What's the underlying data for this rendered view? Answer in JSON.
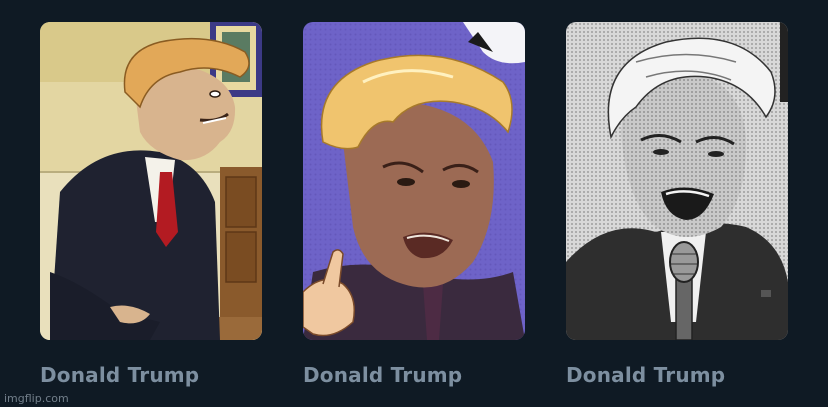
{
  "theme": {
    "background": "#0f1a24",
    "title_color": "#7d8fa0"
  },
  "cards": [
    {
      "title": "Donald Trump",
      "thumb_icon": "cartoon-portrait-office"
    },
    {
      "title": "Donald Trump",
      "thumb_icon": "anime-portrait-pointing"
    },
    {
      "title": "Donald Trump",
      "thumb_icon": "manga-portrait-microphone"
    }
  ],
  "watermark": "imgflip.com"
}
